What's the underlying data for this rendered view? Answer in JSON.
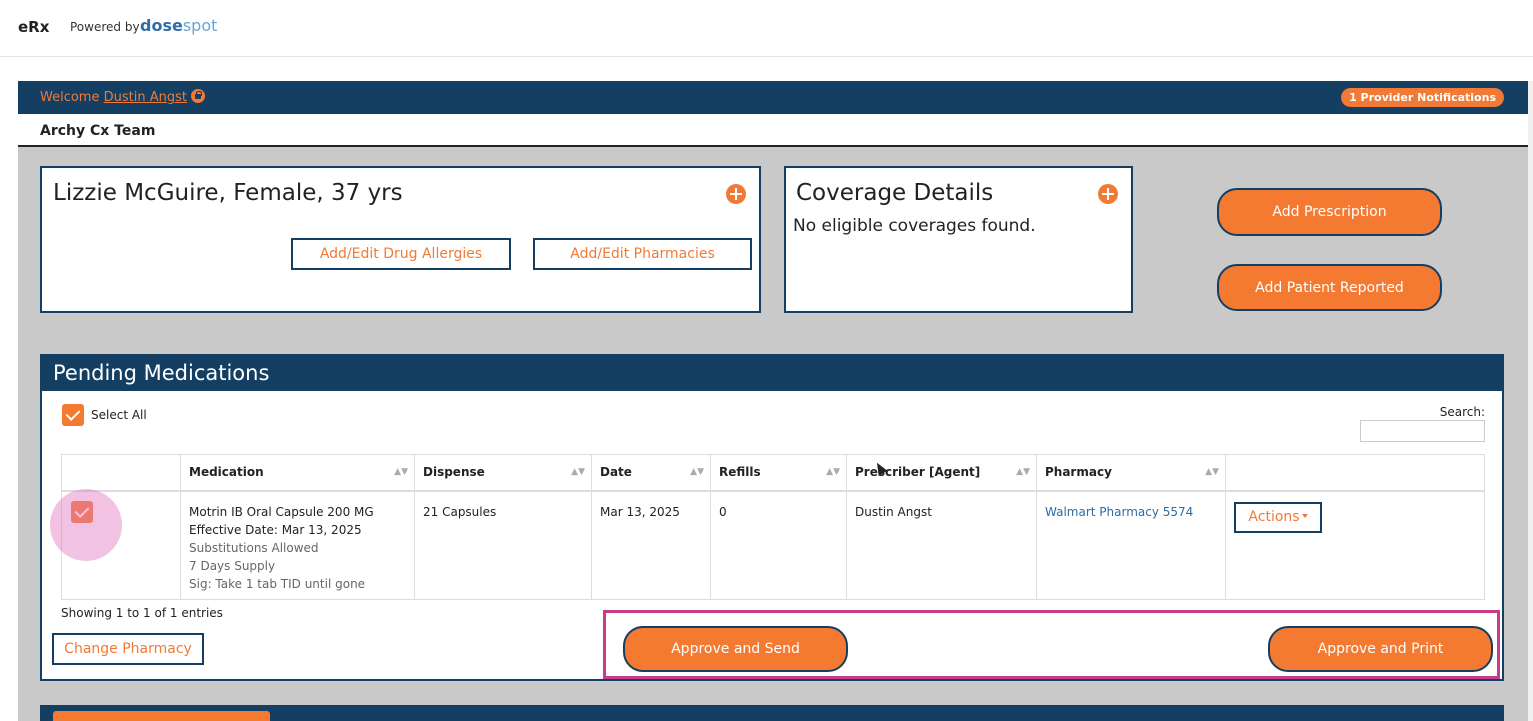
{
  "header": {
    "app_name": "eRx",
    "powered_by": "Powered by",
    "brand_part1": "dose",
    "brand_part2": "spot"
  },
  "welcome_bar": {
    "welcome_text": "Welcome ",
    "user_name": "Dustin Angst",
    "notifications": "1 Provider Notifications"
  },
  "team": "Archy Cx Team",
  "patient": {
    "name": "Lizzie McGuire, Female, 37 yrs",
    "allergies_button": "Add/Edit Drug Allergies",
    "pharmacies_button": "Add/Edit Pharmacies"
  },
  "coverage": {
    "title": "Coverage Details",
    "text": "No eligible coverages found."
  },
  "actions": {
    "add_prescription": "Add Prescription",
    "add_patient_reported": "Add Patient Reported"
  },
  "pending": {
    "title": "Pending Medications",
    "select_all": "Select All",
    "search_label": "Search:",
    "columns": [
      "Medication",
      "Dispense",
      "Date",
      "Refills",
      "Prescriber [Agent]",
      "Pharmacy"
    ],
    "row": {
      "medication_name": "Motrin IB Oral Capsule 200 MG",
      "effective_date": "Effective Date: Mar 13, 2025",
      "substitutions": "Substitutions Allowed",
      "supply": "7 Days Supply",
      "sig": "Sig: Take 1 tab TID until gone",
      "dispense": "21 Capsules",
      "date": "Mar 13, 2025",
      "refills": "0",
      "prescriber": "Dustin Angst",
      "pharmacy": "Walmart Pharmacy 5574",
      "actions_label": "Actions"
    },
    "showing": "Showing 1 to 1 of 1 entries",
    "change_pharmacy": "Change Pharmacy",
    "approve_send": "Approve and Send",
    "approve_print": "Approve and Print"
  },
  "colors": {
    "navy": "#143f63",
    "orange": "#f47a32",
    "highlight": "#c83a8a"
  }
}
